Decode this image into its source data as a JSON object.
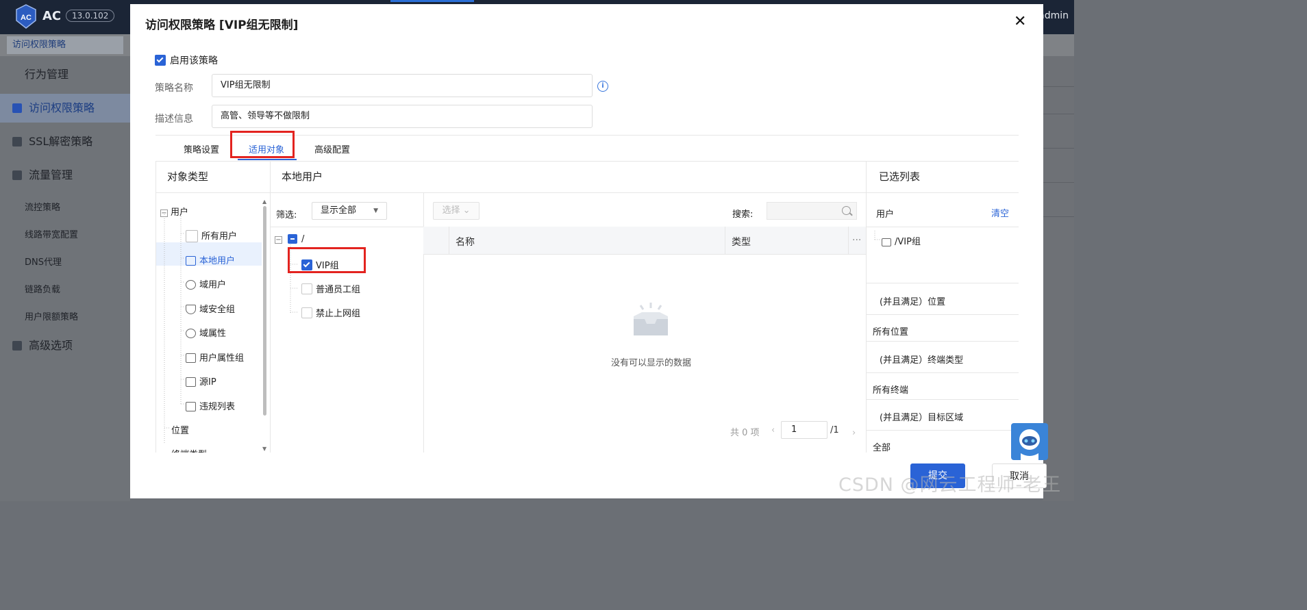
{
  "app": {
    "logo_text": "AC",
    "version": "13.0.102",
    "user": "admin",
    "breadcrumb_tab": "访问权限策略"
  },
  "sidebar": {
    "items": [
      {
        "label": "行为管理",
        "icon": "none"
      },
      {
        "label": "访问权限策略",
        "icon": "policy-icon"
      },
      {
        "label": "SSL解密策略",
        "icon": "ssl-icon"
      },
      {
        "label": "流量管理",
        "icon": "traffic-icon"
      },
      {
        "label": "高级选项",
        "icon": "grid-icon"
      }
    ],
    "subitems": [
      "流控策略",
      "线路带宽配置",
      "DNS代理",
      "链路负载",
      "用户限额策略"
    ]
  },
  "modal": {
    "title": "访问权限策略 [VIP组无限制]",
    "close": "✕",
    "enable_label": "启用该策略",
    "enable_checked": true,
    "name_label": "策略名称",
    "name_value": "VIP组无限制",
    "desc_label": "描述信息",
    "desc_value": "高管、领导等不做限制",
    "tabs": [
      "策略设置",
      "适用对象",
      "高级配置"
    ],
    "active_tab": "适用对象",
    "columns": {
      "types_header": "对象类型",
      "users_header": "本地用户",
      "selected_header": "已选列表"
    },
    "type_tree": {
      "root": "用户",
      "children": [
        "所有用户",
        "本地用户",
        "域用户",
        "域安全组",
        "域属性",
        "用户属性组",
        "源IP",
        "违规列表"
      ],
      "others": [
        "位置",
        "终端类型"
      ]
    },
    "filter": {
      "label": "筛选:",
      "value": "显示全部"
    },
    "group_tree": {
      "root": "/",
      "groups": [
        {
          "name": "VIP组",
          "checked": true
        },
        {
          "name": "普通员工组",
          "checked": false
        },
        {
          "name": "禁止上网组",
          "checked": false
        }
      ]
    },
    "grid": {
      "choose_btn": "选择",
      "search_label": "搜索:",
      "headers": [
        "名称",
        "类型"
      ],
      "more": "···",
      "empty_text": "没有可以显示的数据",
      "total": "共 0 项",
      "page": "1",
      "page_of": "/1"
    },
    "selected": {
      "users_label": "用户",
      "clear_label": "清空",
      "user_items": [
        "/VIP组"
      ],
      "conditions": [
        {
          "label": "(并且满足）位置",
          "value": "所有位置"
        },
        {
          "label": "(并且满足）终端类型",
          "value": "所有终端"
        },
        {
          "label": "(并且满足）目标区域",
          "value": "全部"
        }
      ]
    },
    "footer": {
      "submit": "提交",
      "cancel": "取消"
    }
  },
  "watermark": "CSDN @网云工程师-老王",
  "colors": {
    "accent": "#2a63d6",
    "highlight": "#e3231f"
  }
}
